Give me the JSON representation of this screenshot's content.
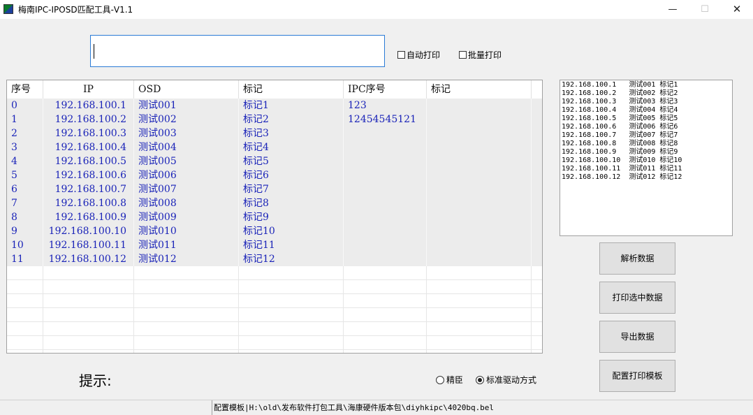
{
  "window": {
    "title": "梅南IPC-IPOSD匹配工具-V1.1",
    "min": "—",
    "max": "☐",
    "close": "✕"
  },
  "input": {
    "value": ""
  },
  "options": {
    "auto_print": "自动打印",
    "batch_print": "批量打印"
  },
  "grid": {
    "columns": [
      "序号",
      "IP",
      "OSD",
      "标记",
      "IPC序号",
      "标记"
    ],
    "rows": [
      [
        "0",
        "192.168.100.1",
        "测试001",
        "标记1",
        "123",
        ""
      ],
      [
        "1",
        "192.168.100.2",
        "测试002",
        "标记2",
        "12454545121",
        ""
      ],
      [
        "2",
        "192.168.100.3",
        "测试003",
        "标记3",
        "",
        ""
      ],
      [
        "3",
        "192.168.100.4",
        "测试004",
        "标记4",
        "",
        ""
      ],
      [
        "4",
        "192.168.100.5",
        "测试005",
        "标记5",
        "",
        ""
      ],
      [
        "5",
        "192.168.100.6",
        "测试006",
        "标记6",
        "",
        ""
      ],
      [
        "6",
        "192.168.100.7",
        "测试007",
        "标记7",
        "",
        ""
      ],
      [
        "7",
        "192.168.100.8",
        "测试008",
        "标记8",
        "",
        ""
      ],
      [
        "8",
        "192.168.100.9",
        "测试009",
        "标记9",
        "",
        ""
      ],
      [
        "9",
        "192.168.100.10",
        "测试010",
        "标记10",
        "",
        ""
      ],
      [
        "10",
        "192.168.100.11",
        "测试011",
        "标记11",
        "",
        ""
      ],
      [
        "11",
        "192.168.100.12",
        "测试012",
        "标记12",
        "",
        ""
      ]
    ]
  },
  "raw_list": [
    "192.168.100.1   测试001 标记1",
    "192.168.100.2   测试002 标记2",
    "192.168.100.3   测试003 标记3",
    "192.168.100.4   测试004 标记4",
    "192.168.100.5   测试005 标记5",
    "192.168.100.6   测试006 标记6",
    "192.168.100.7   测试007 标记7",
    "192.168.100.8   测试008 标记8",
    "192.168.100.9   测试009 标记9",
    "192.168.100.10  测试010 标记10",
    "192.168.100.11  测试011 标记11",
    "192.168.100.12  测试012 标记12"
  ],
  "buttons": {
    "parse": "解析数据",
    "print_selected": "打印选中数据",
    "export": "导出数据",
    "config_template": "配置打印模板"
  },
  "hint": {
    "label": "提示:"
  },
  "radios": {
    "option1": "精臣",
    "option2": "标准驱动方式",
    "selected": "option2"
  },
  "status": {
    "text": "配置模板|H:\\old\\发布软件打包工具\\海康硬件版本包\\diyhkipc\\4020bq.bel"
  }
}
